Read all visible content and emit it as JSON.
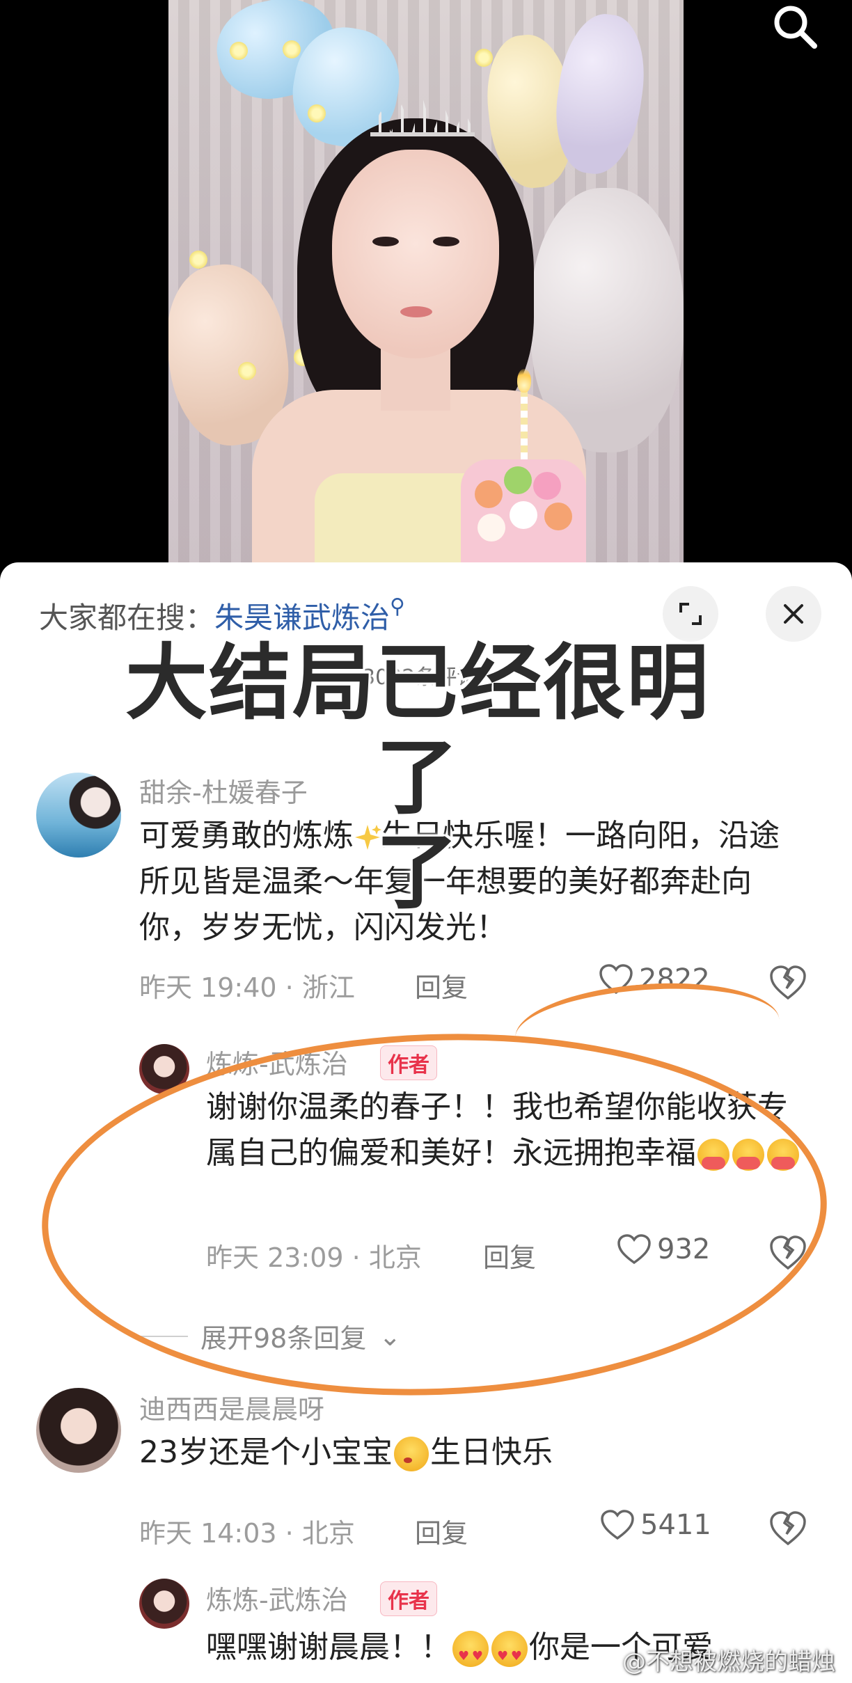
{
  "video": {
    "search_icon": "search-icon"
  },
  "sheet": {
    "search_hint_label": "大家都在搜：",
    "search_hint_term": "朱昊谦武炼治",
    "search_hint_icon": "search-icon",
    "comment_count_text": "3032条评论",
    "expand_icon": "expand-icon",
    "close_icon": "close-icon"
  },
  "overlay": {
    "caption_line1": "大结局已经很明了",
    "caption_line2": "了"
  },
  "comments": [
    {
      "username": "甜余-杜媛春子",
      "text": "可爱勇敢的炼炼",
      "text_emoji": "sparkles",
      "text_after": "生日快乐喔！一路向阳，沿途所见皆是温柔～年复一年想要的美好都奔赴向你，岁岁无忧，闪闪发光！",
      "time": "昨天 19:40",
      "location": "浙江",
      "reply_label": "回复",
      "likes": "2822"
    },
    {
      "username": "炼炼-武炼治",
      "badge": "作者",
      "text": "谢谢你温柔的春子！！我也希望你能收获专属自己的偏爱和美好！永远拥抱幸福",
      "text_emoji": "hugging-face",
      "time": "昨天 23:09",
      "location": "北京",
      "reply_label": "回复",
      "likes": "932"
    },
    {
      "expand_label": "展开98条回复"
    },
    {
      "username": "迪西西是晨晨呀",
      "text": "23岁还是个小宝宝",
      "text_emoji": "kissing-face",
      "text_after": "生日快乐",
      "time": "昨天 14:03",
      "location": "北京",
      "reply_label": "回复",
      "likes": "5411"
    },
    {
      "username": "炼炼-武炼治",
      "badge": "作者",
      "text": "嘿嘿谢谢晨晨！！",
      "text_emoji": "smiling-face-with-hearts",
      "text_after": "你是一个可爱"
    }
  ],
  "watermark": "@不想被燃烧的蜡烛",
  "colors": {
    "link_blue": "#2f5ea8",
    "author_red": "#e8334b",
    "highlight_orange": "#ee8e3f"
  }
}
